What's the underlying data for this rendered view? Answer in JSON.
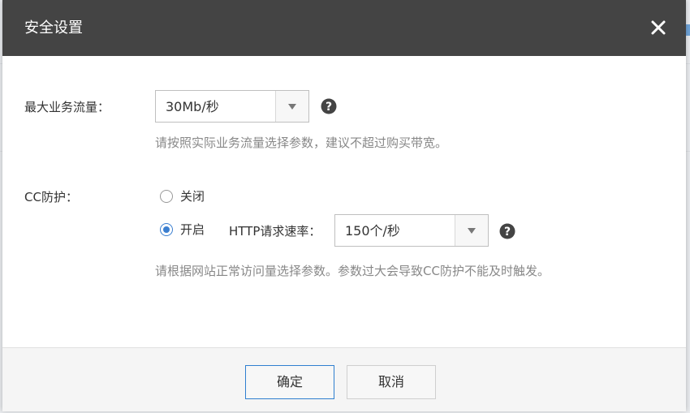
{
  "dialog": {
    "title": "安全设置"
  },
  "bandwidth": {
    "label": "最大业务流量：",
    "value": "30Mb/秒",
    "hint": "请按照实际业务流量选择参数，建议不超过购买带宽。"
  },
  "cc": {
    "label": "CC防护：",
    "off_label": "关闭",
    "on_label": "开启",
    "selected": "on",
    "http_rate_label": "HTTP请求速率：",
    "http_rate_value": "150个/秒",
    "hint": "请根据网站正常访问量选择参数。参数过大会导致CC防护不能及时触发。"
  },
  "footer": {
    "confirm_label": "确定",
    "cancel_label": "取消"
  },
  "colors": {
    "header_bg": "#444444",
    "accent": "#3b7fd0"
  }
}
